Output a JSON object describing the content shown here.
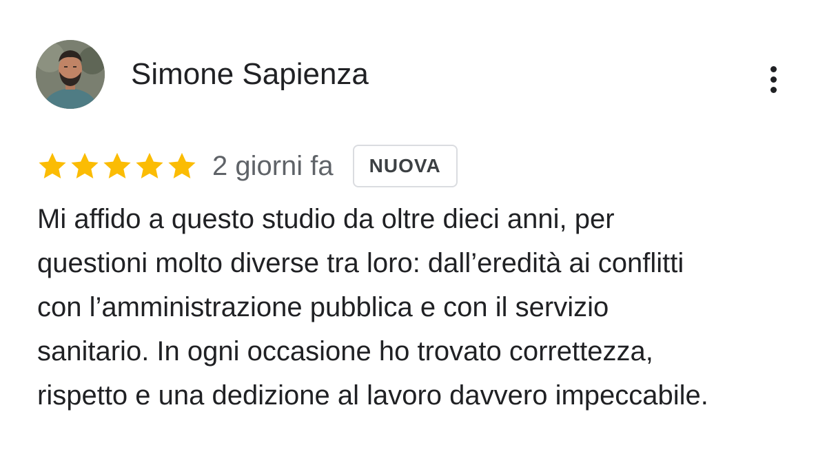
{
  "review": {
    "author": {
      "name": "Simone Sapienza",
      "avatar_icon": "profile-photo"
    },
    "more_options_icon": "more-vert-icon",
    "rating": {
      "stars": 5,
      "max": 5,
      "star_color": "#fbbc04"
    },
    "date": "2 giorni fa",
    "badge": "NUOVA",
    "text_lines": [
      "Mi affido a questo studio da oltre dieci anni, per",
      "questioni molto diverse tra loro: dall’eredità ai conflitti",
      "con l’amministrazione pubblica e con il servizio",
      "sanitario. In ogni occasione ho trovato correttezza,",
      "rispetto e una dedizione al lavoro davvero impeccabile."
    ]
  }
}
